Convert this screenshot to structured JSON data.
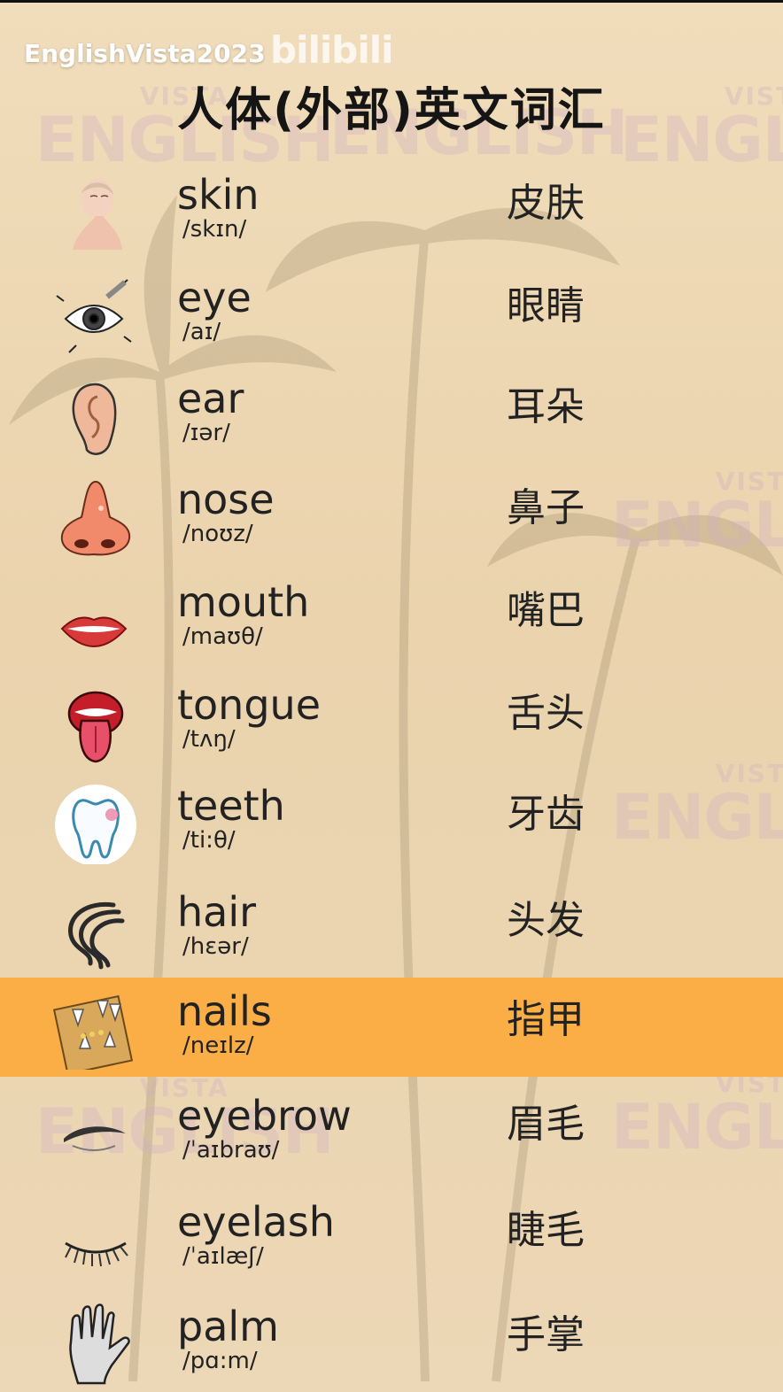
{
  "header": {
    "brand": "EnglishVista2023",
    "site_watermark": "bilibili",
    "title": "人体(外部)英文词汇"
  },
  "watermark": {
    "small": "VISTA",
    "large": "ENGLISH"
  },
  "colors": {
    "background": "#ead3ad",
    "highlight": "#fbae45",
    "text": "#222222"
  },
  "vocab": [
    {
      "word": "skin",
      "ipa": "/skɪn/",
      "zh": "皮肤",
      "icon": "skin-icon"
    },
    {
      "word": "eye",
      "ipa": "/aɪ/",
      "zh": "眼睛",
      "icon": "eye-icon"
    },
    {
      "word": "ear",
      "ipa": "/ɪər/",
      "zh": "耳朵",
      "icon": "ear-icon"
    },
    {
      "word": "nose",
      "ipa": "/noʊz/",
      "zh": "鼻子",
      "icon": "nose-icon"
    },
    {
      "word": "mouth",
      "ipa": "/maʊθ/",
      "zh": "嘴巴",
      "icon": "mouth-icon"
    },
    {
      "word": "tongue",
      "ipa": "/tʌŋ/",
      "zh": "舌头",
      "icon": "tongue-icon"
    },
    {
      "word": "teeth",
      "ipa": "/ti:θ/",
      "zh": "牙齿",
      "icon": "tooth-icon"
    },
    {
      "word": "hair",
      "ipa": "/hɛər/",
      "zh": "头发",
      "icon": "hair-icon"
    },
    {
      "word": "nails",
      "ipa": "/neɪlz/",
      "zh": "指甲",
      "icon": "nails-icon",
      "highlighted": true
    },
    {
      "word": "eyebrow",
      "ipa": "/ˈaɪbraʊ/",
      "zh": "眉毛",
      "icon": "eyebrow-icon"
    },
    {
      "word": "eyelash",
      "ipa": "/ˈaɪlæʃ/",
      "zh": "睫毛",
      "icon": "eyelash-icon"
    },
    {
      "word": "palm",
      "ipa": "/pɑ:m/",
      "zh": "手掌",
      "icon": "palm-hand-icon"
    }
  ]
}
